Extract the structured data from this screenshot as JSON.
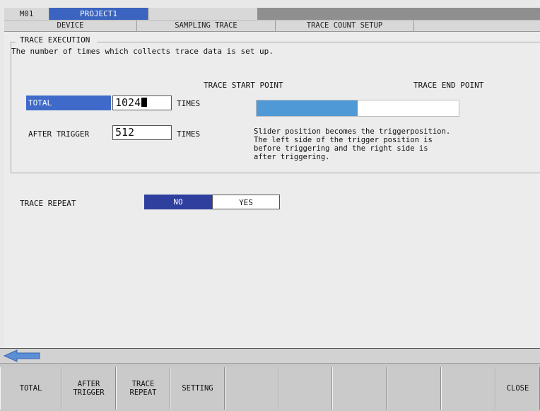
{
  "header": {
    "station": "M01",
    "project": "PROJECT1"
  },
  "tabs": [
    {
      "label": "DEVICE"
    },
    {
      "label": "SAMPLING TRACE"
    },
    {
      "label": "TRACE COUNT SETUP"
    },
    {
      "label": ""
    }
  ],
  "description": "The number of times which collects trace data is set up.",
  "trace_execution": {
    "legend": "TRACE EXECUTION",
    "start_point_label": "TRACE START POINT",
    "end_point_label": "TRACE END POINT",
    "total_label": "TOTAL",
    "total_value": "1024",
    "total_unit": "TIMES",
    "after_trigger_label": "AFTER  TRIGGER",
    "after_trigger_value": "512",
    "after_trigger_unit": "TIMES",
    "trigger_position_fraction": 0.5,
    "hint": "Slider position becomes the triggerposition.\nThe left side of the trigger position is\nbefore triggering and the right side is\nafter triggering."
  },
  "trace_repeat": {
    "label": "TRACE REPEAT",
    "options": [
      "NO",
      "YES"
    ],
    "selected": "NO"
  },
  "colors": {
    "selected_blue": "#3f6ac9",
    "dark_blue": "#2e3f9e",
    "slider_fill": "#4f9ad6"
  },
  "icons": {
    "back": "left-arrow-icon"
  },
  "function_keys": [
    {
      "label": "TOTAL"
    },
    {
      "label": "AFTER\nTRIGGER"
    },
    {
      "label": "TRACE\nREPEAT"
    },
    {
      "label": "SETTING"
    },
    {
      "label": ""
    },
    {
      "label": ""
    },
    {
      "label": ""
    },
    {
      "label": ""
    },
    {
      "label": ""
    },
    {
      "label": "CLOSE"
    }
  ]
}
